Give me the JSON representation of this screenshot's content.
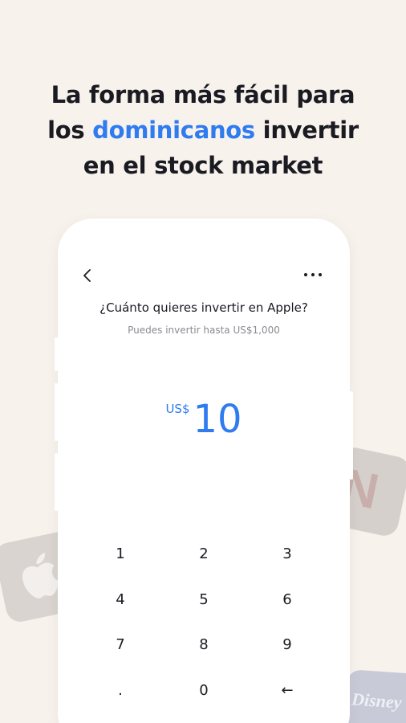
{
  "headline": {
    "line1": "La forma más fácil para",
    "line2_pre": "los ",
    "line2_accent": "dominicanos",
    "line2_post": " invertir",
    "line3": "en el stock market"
  },
  "colors": {
    "background": "#f8f2ec",
    "accent": "#2f7bf0",
    "text": "#1a1a22",
    "muted": "#8a8a92"
  },
  "app": {
    "question": "¿Cuánto quieres invertir en Apple?",
    "hint": "Puedes invertir hasta US$1,000",
    "currency": "US$",
    "amount": "10",
    "icons": {
      "back": "chevron-left-icon",
      "more": "more-horizontal-icon"
    },
    "keypad": {
      "k1": "1",
      "k2": "2",
      "k3": "3",
      "k4": "4",
      "k5": "5",
      "k6": "6",
      "k7": "7",
      "k8": "8",
      "k9": "9",
      "kdot": ".",
      "k0": "0",
      "kback": "←"
    }
  },
  "background_logos": [
    "apple-logo-icon",
    "netflix-logo-icon",
    "disney-logo-icon"
  ],
  "logo_text": {
    "netflix": "N",
    "disney": "Disney"
  }
}
